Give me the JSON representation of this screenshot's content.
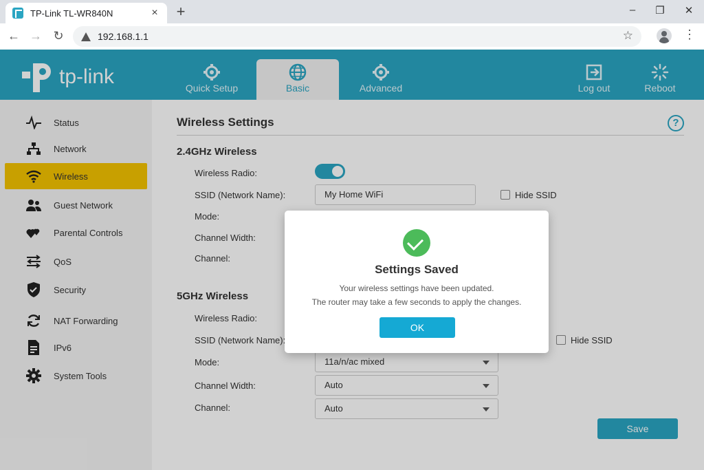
{
  "browser": {
    "tab_title": "TP-Link TL-WR840N",
    "tab_close": "×",
    "new_tab": "+",
    "win_min": "–",
    "win_max": "❐",
    "win_close": "✕",
    "back": "←",
    "forward": "→",
    "reload": "↻",
    "url": "192.168.1.1",
    "star": "☆",
    "menu": "⋮"
  },
  "header": {
    "logo_text": "tp-link",
    "nav": [
      {
        "label": "Quick Setup",
        "icon": "gear-icon"
      },
      {
        "label": "Basic",
        "icon": "globe-icon"
      },
      {
        "label": "Advanced",
        "icon": "gear-icon"
      },
      {
        "label": "Log out",
        "icon": "logout-icon"
      },
      {
        "label": "Reboot",
        "icon": "reboot-icon"
      }
    ],
    "active_nav": "Basic"
  },
  "sidebar": {
    "items": [
      {
        "label": "Status",
        "icon": "pulse-icon"
      },
      {
        "label": "Network",
        "icon": "network-icon"
      },
      {
        "label": "Wireless",
        "icon": "wifi-icon"
      },
      {
        "label": "Guest Network",
        "icon": "guests-icon"
      },
      {
        "label": "Parental Controls",
        "icon": "hearts-icon"
      },
      {
        "label": "QoS",
        "icon": "qos-arrows-icon"
      },
      {
        "label": "Security",
        "icon": "shield-icon"
      },
      {
        "label": "NAT Forwarding",
        "icon": "refresh-icon"
      },
      {
        "label": "IPv6",
        "icon": "ipv6-icon"
      },
      {
        "label": "System Tools",
        "icon": "cog-icon"
      }
    ],
    "active": "Wireless"
  },
  "main": {
    "title": "Wireless Settings",
    "help": "?",
    "band24": {
      "heading": "2.4GHz Wireless",
      "radio_label": "Wireless Radio:",
      "radio_on": true,
      "ssid_label": "SSID (Network Name):",
      "ssid_value": "My Home WiFi",
      "hide_ssid_label": "Hide SSID",
      "mode_label": "Mode:",
      "width_label": "Channel Width:",
      "channel_label": "Channel:"
    },
    "band5": {
      "heading": "5GHz Wireless",
      "radio_label": "Wireless Radio:",
      "ssid_label": "SSID (Network Name):",
      "hide_ssid_label": "Hide SSID",
      "mode_label": "Mode:",
      "mode_value": "11a/n/ac mixed",
      "width_label": "Channel Width:",
      "width_value": "Auto",
      "channel_label": "Channel:",
      "channel_value": "Auto"
    },
    "save_label": "Save"
  },
  "modal": {
    "title": "Settings Saved",
    "line1": "Your wireless settings have been updated.",
    "line2": "The router may take a few seconds to apply the changes.",
    "ok_label": "OK"
  },
  "colors": {
    "brand": "#2aa5c2",
    "active_side": "#f5c400",
    "success": "#4cbb5a",
    "ok_button": "#15a9d4"
  }
}
